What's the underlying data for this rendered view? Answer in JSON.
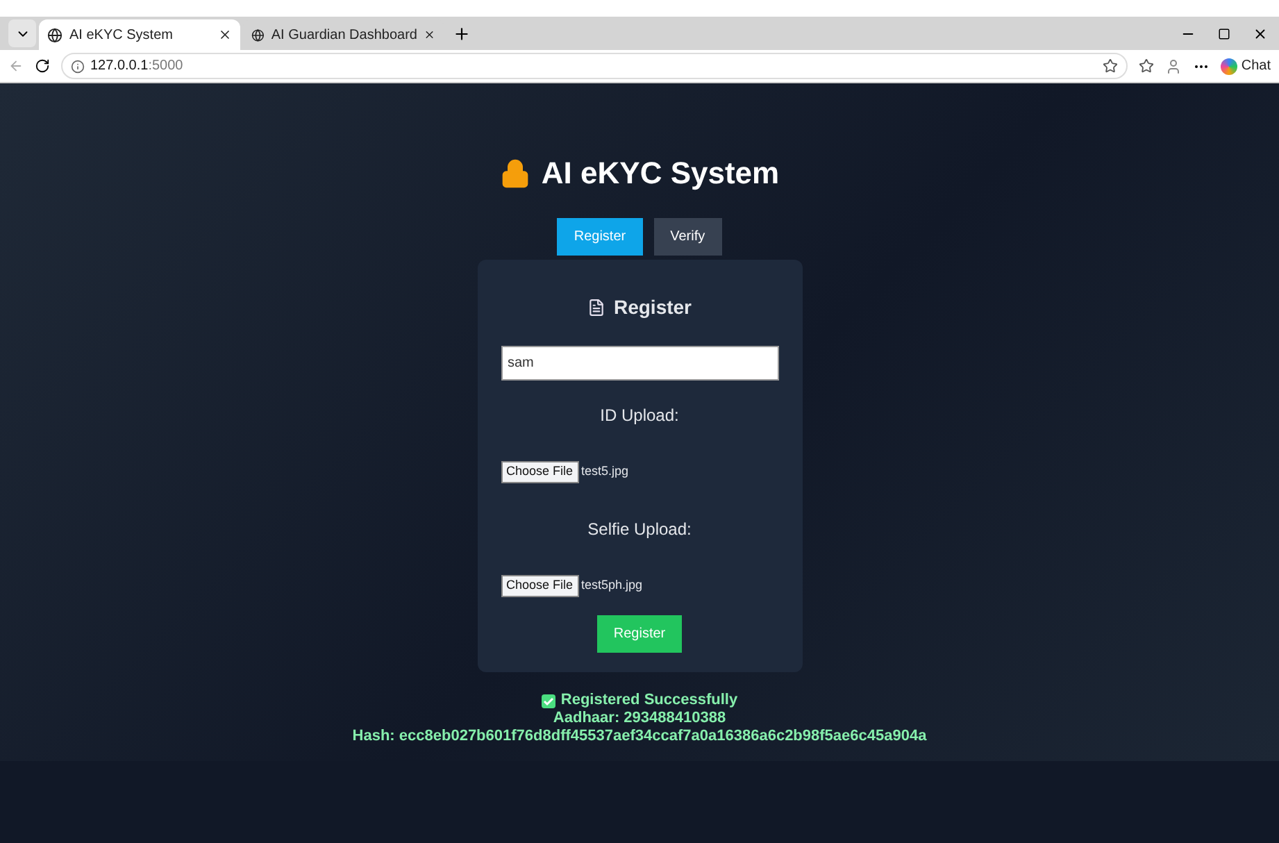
{
  "browser": {
    "tabs": [
      {
        "title": "AI eKYC System",
        "selected": true
      },
      {
        "title": "AI Guardian Dashboard",
        "selected": false
      }
    ],
    "url_host": "127.0.0.1",
    "url_port": ":5000",
    "chat_label": "Chat"
  },
  "app": {
    "title": "AI eKYC System",
    "tabs": [
      {
        "label": "Register",
        "selected": true
      },
      {
        "label": "Verify",
        "selected": false
      }
    ],
    "form": {
      "heading": "Register",
      "name_value": "sam",
      "uploads": [
        {
          "label": "ID Upload:",
          "button": "Choose File",
          "file": "test5.jpg"
        },
        {
          "label": "Selfie Upload:",
          "button": "Choose File",
          "file": "test5ph.jpg"
        }
      ],
      "submit": "Register"
    },
    "result": {
      "lines": [
        "Registered Successfully",
        "Aadhaar: 293488410388",
        "Hash: ecc8eb027b601f76d8dff45537aef34ccaf7a0a16386a6c2b98f5ae6c45a904a"
      ]
    }
  }
}
